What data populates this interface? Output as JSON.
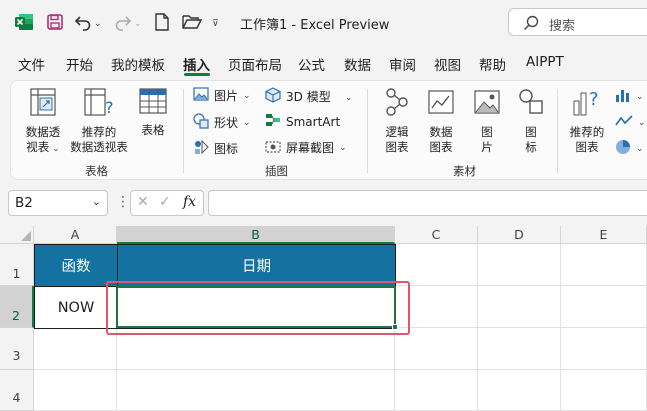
{
  "titlebar": {
    "doc_title": "工作簿1  -  Excel Preview",
    "search_placeholder": "搜索"
  },
  "menu": {
    "items": [
      "文件",
      "开始",
      "我的模板",
      "插入",
      "页面布局",
      "公式",
      "数据",
      "审阅",
      "视图",
      "帮助",
      "AIPPT"
    ],
    "active": "插入"
  },
  "ribbon": {
    "groups": {
      "tables": {
        "label": "表格",
        "pivot_table": [
          "数据透",
          "视表"
        ],
        "recommended_pivot": [
          "推荐的",
          "数据透视表"
        ],
        "table": "表格"
      },
      "illustrations": {
        "label": "插图",
        "picture": "图片",
        "shapes": "形状",
        "icons": "图标",
        "model_3d": "3D 模型",
        "smartart": "SmartArt",
        "screenshot": "屏幕截图"
      },
      "materials": {
        "label": "素材",
        "logic_chart": [
          "逻辑",
          "图表"
        ],
        "data_chart": [
          "数据",
          "图表"
        ],
        "pictures": [
          "图",
          "片"
        ],
        "icons": [
          "图",
          "标"
        ]
      },
      "charts": {
        "recommended_charts": [
          "推荐的",
          "图表"
        ]
      }
    }
  },
  "formula_bar": {
    "name_box": "B2",
    "fx": "fx",
    "formula": ""
  },
  "sheet": {
    "columns": [
      "A",
      "B",
      "C",
      "D",
      "E"
    ],
    "rows": [
      "1",
      "2",
      "3",
      "4"
    ],
    "cells": {
      "A1": "函数",
      "B1": "日期",
      "A2": "NOW",
      "B2": ""
    },
    "selected_cell": "B2",
    "header_fill": "#1472A0",
    "highlight_color": "#E0576C",
    "accent": "#107C41"
  }
}
